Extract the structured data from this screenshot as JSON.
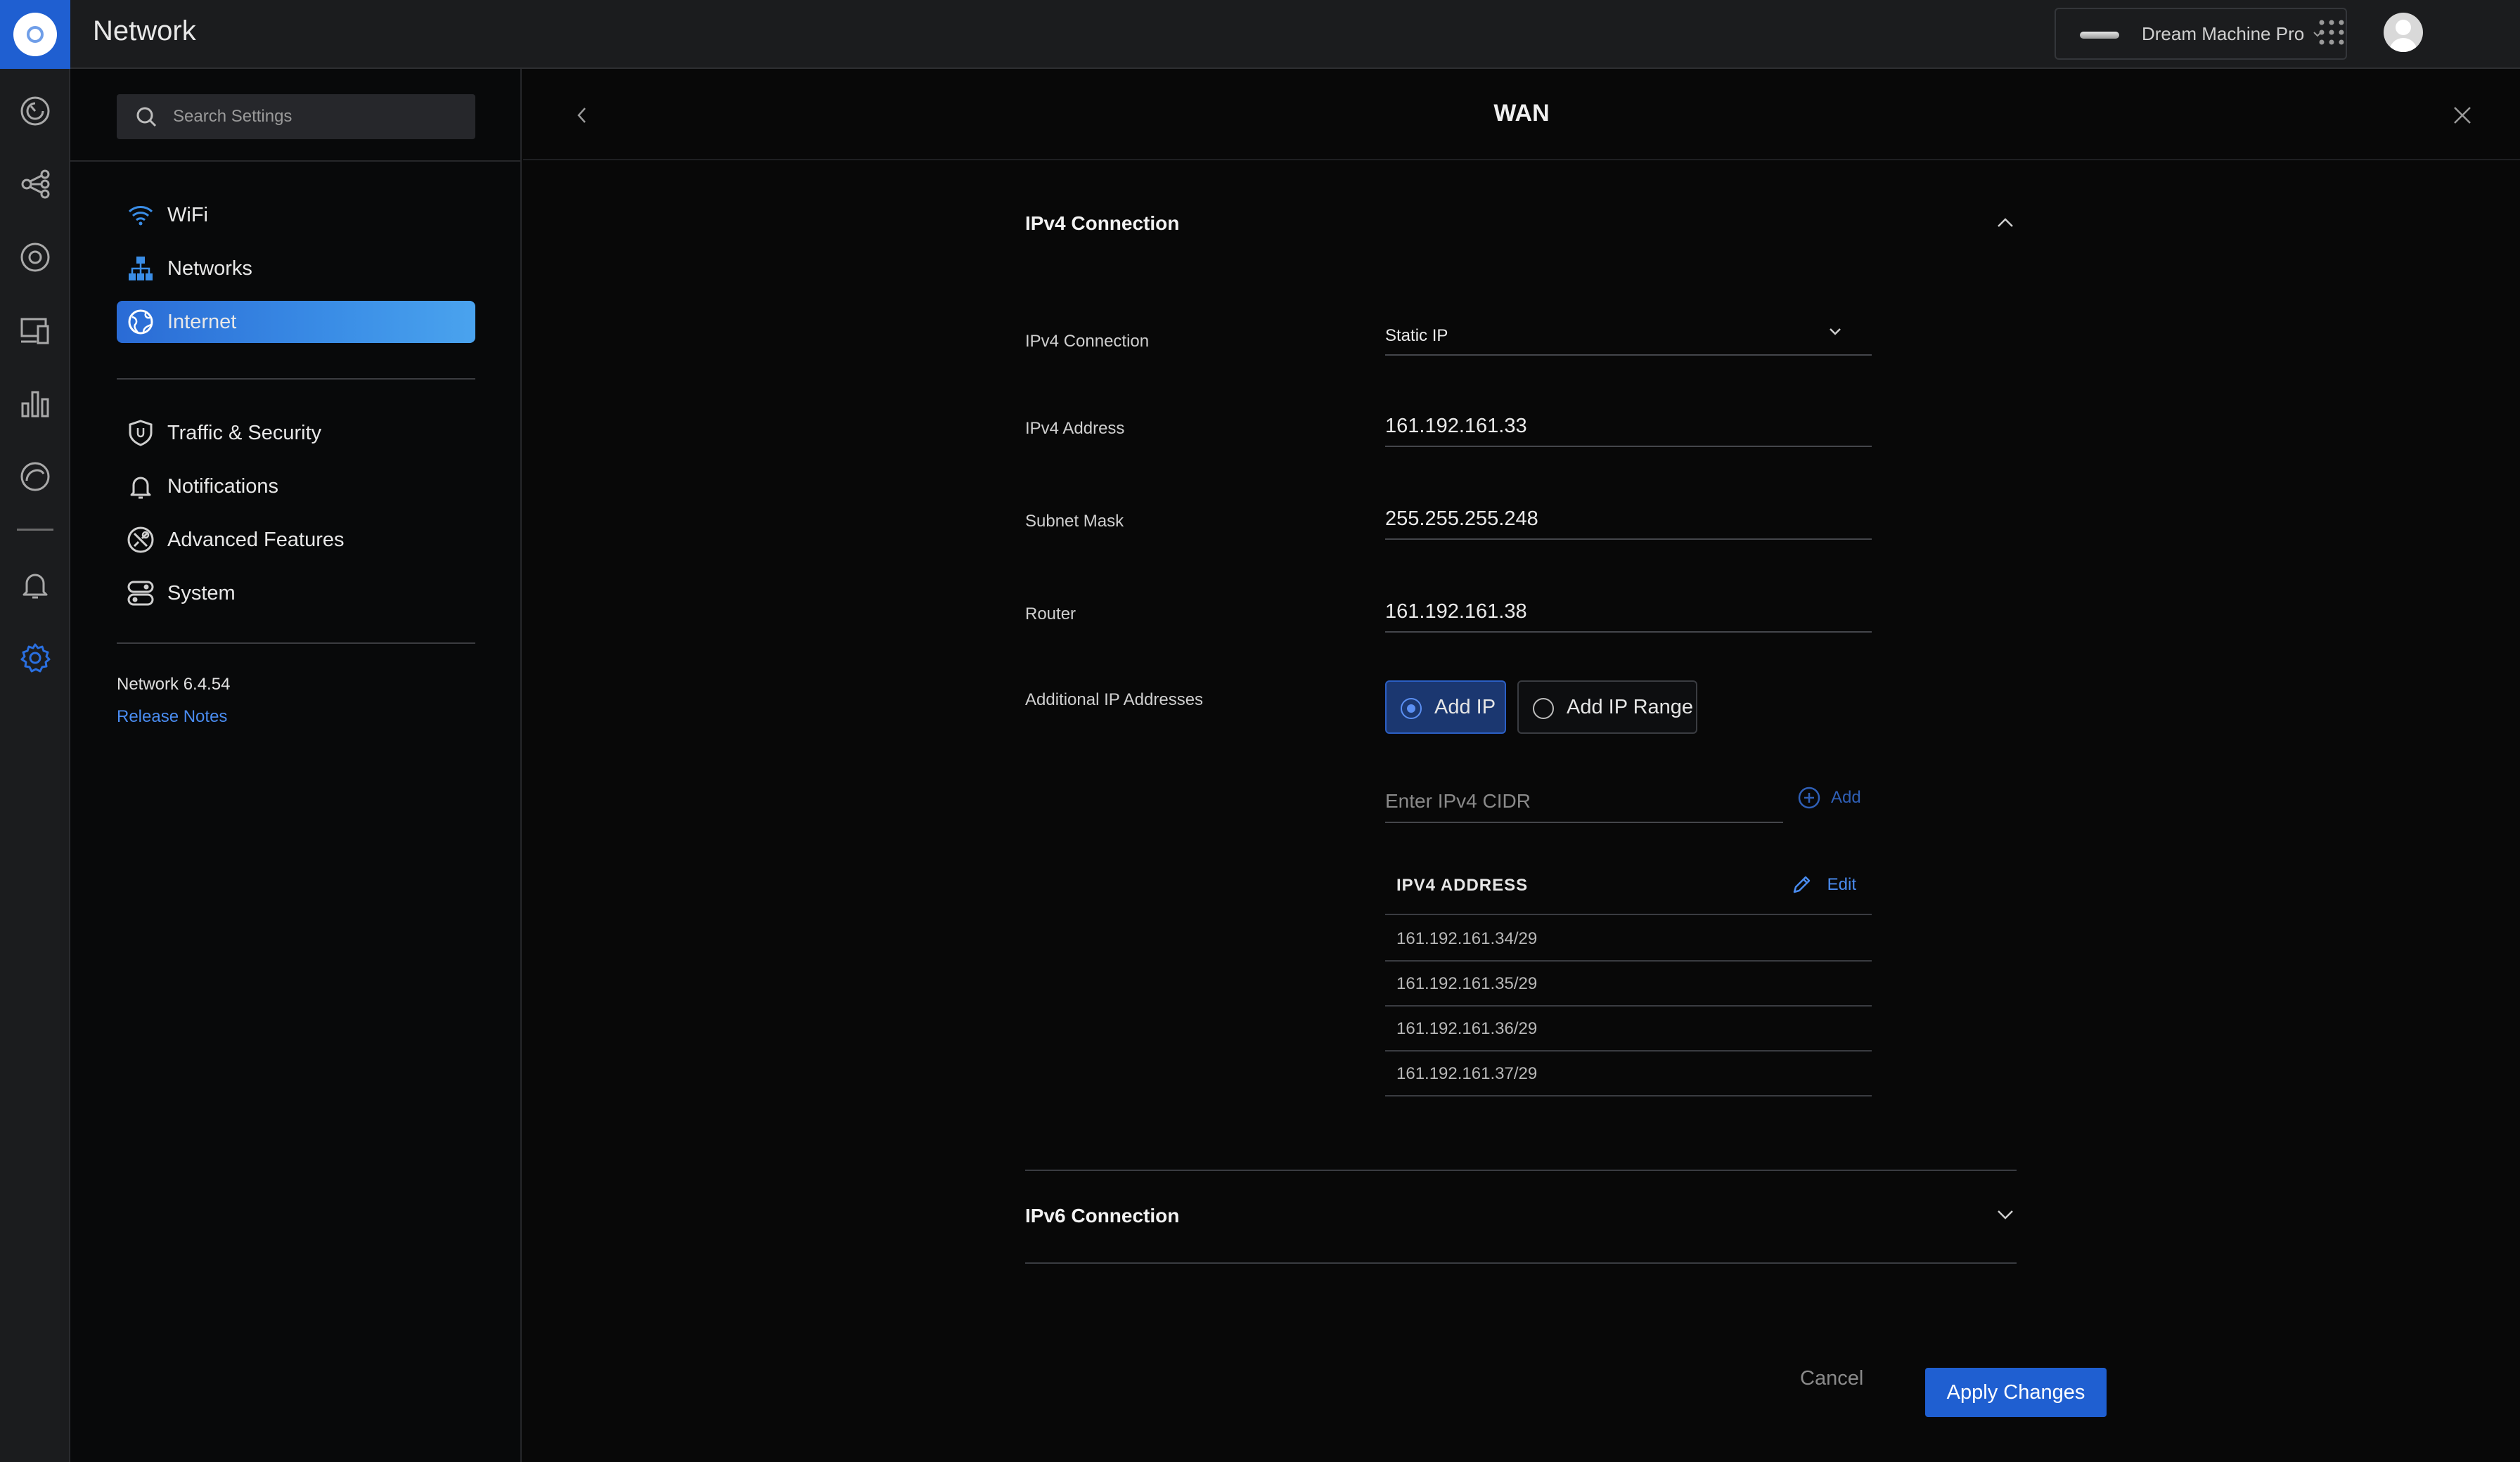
{
  "app": {
    "title": "Network"
  },
  "device": {
    "name": "Dream Machine Pro"
  },
  "search": {
    "placeholder": "Search Settings"
  },
  "sidebar": {
    "primary_items": [
      {
        "label": "WiFi",
        "icon": "wifi-icon"
      },
      {
        "label": "Networks",
        "icon": "network-topology-icon"
      },
      {
        "label": "Internet",
        "icon": "globe-icon",
        "active": true
      }
    ],
    "secondary_items": [
      {
        "label": "Traffic & Security",
        "icon": "shield-icon"
      },
      {
        "label": "Notifications",
        "icon": "bell-icon"
      },
      {
        "label": "Advanced Features",
        "icon": "tools-icon"
      },
      {
        "label": "System",
        "icon": "toggles-icon"
      }
    ],
    "version": "Network 6.4.54",
    "release_notes": "Release Notes"
  },
  "panel": {
    "title": "WAN"
  },
  "ipv4": {
    "section_title": "IPv4 Connection",
    "connection_label": "IPv4 Connection",
    "connection_value": "Static IP",
    "address_label": "IPv4 Address",
    "address_value": "161.192.161.33",
    "subnet_label": "Subnet Mask",
    "subnet_value": "255.255.255.248",
    "router_label": "Router",
    "router_value": "161.192.161.38",
    "additional_label": "Additional IP Addresses",
    "options": [
      "Add IP",
      "Add IP Range"
    ],
    "selected_option": "Add IP",
    "cidr_placeholder": "Enter IPv4 CIDR",
    "add_label": "Add",
    "table_header": "IPV4 ADDRESS",
    "edit_label": "Edit",
    "addresses": [
      "161.192.161.34/29",
      "161.192.161.35/29",
      "161.192.161.36/29",
      "161.192.161.37/29"
    ]
  },
  "ipv6": {
    "section_title": "IPv6 Connection"
  },
  "actions": {
    "cancel": "Cancel",
    "apply": "Apply Changes"
  },
  "colors": {
    "accent": "#1f5fd1",
    "link": "#4a8cf0",
    "rail_active": "#2a6fe0"
  }
}
